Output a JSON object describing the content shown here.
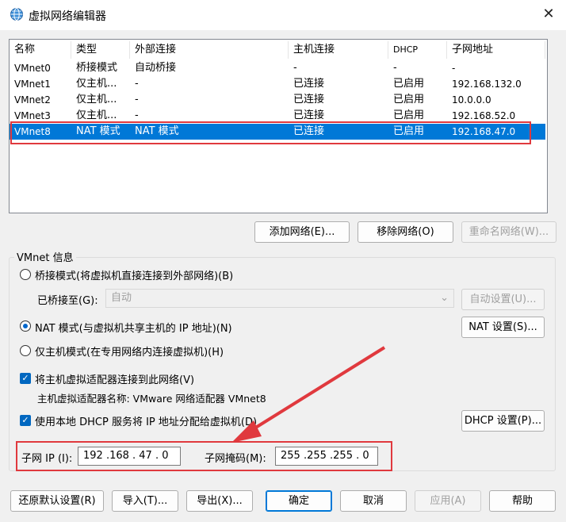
{
  "window": {
    "title": "虚拟网络编辑器",
    "close_icon": "✕"
  },
  "table": {
    "columns": [
      "名称",
      "类型",
      "外部连接",
      "主机连接",
      "DHCP",
      "子网地址"
    ],
    "rows": [
      [
        "VMnet0",
        "桥接模式",
        "自动桥接",
        "-",
        "-",
        "-"
      ],
      [
        "VMnet1",
        "仅主机...",
        "-",
        "已连接",
        "已启用",
        "192.168.132.0"
      ],
      [
        "VMnet2",
        "仅主机...",
        "-",
        "已连接",
        "已启用",
        "10.0.0.0"
      ],
      [
        "VMnet3",
        "仅主机...",
        "-",
        "已连接",
        "已启用",
        "192.168.52.0"
      ],
      [
        "VMnet8",
        "NAT 模式",
        "NAT 模式",
        "已连接",
        "已启用",
        "192.168.47.0"
      ]
    ],
    "selected_row": 4
  },
  "list_buttons": {
    "add": "添加网络(E)...",
    "remove": "移除网络(O)",
    "rename": "重命名网络(W)..."
  },
  "vmnet_info": {
    "group_label": "VMnet 信息",
    "bridged_label": "桥接模式(将虚拟机直接连接到外部网络)(B)",
    "bridged_to_label": "已桥接至(G):",
    "bridged_to_value": "自动",
    "auto_settings": "自动设置(U)...",
    "nat_label": "NAT 模式(与虚拟机共享主机的 IP 地址)(N)",
    "nat_settings": "NAT 设置(S)...",
    "hostonly_label": "仅主机模式(在专用网络内连接虚拟机)(H)",
    "connect_adapter_label": "将主机虚拟适配器连接到此网络(V)",
    "adapter_name_text": "主机虚拟适配器名称: VMware 网络适配器 VMnet8",
    "dhcp_label": "使用本地 DHCP 服务将 IP 地址分配给虚拟机(D)",
    "dhcp_settings": "DHCP 设置(P)...",
    "subnet_ip_label": "子网 IP (I):",
    "subnet_ip_value": "192 .168 . 47 . 0",
    "subnet_mask_label": "子网掩码(M):",
    "subnet_mask_value": "255 .255 .255 . 0",
    "selected_mode": "nat"
  },
  "footer_buttons": {
    "restore": "还原默认设置(R)",
    "import": "导入(T)...",
    "export": "导出(X)...",
    "ok": "确定",
    "cancel": "取消",
    "apply": "应用(A)",
    "help": "帮助"
  },
  "colors": {
    "selection": "#0078d7",
    "annotation": "#e0393e",
    "accent": "#0067c0"
  }
}
